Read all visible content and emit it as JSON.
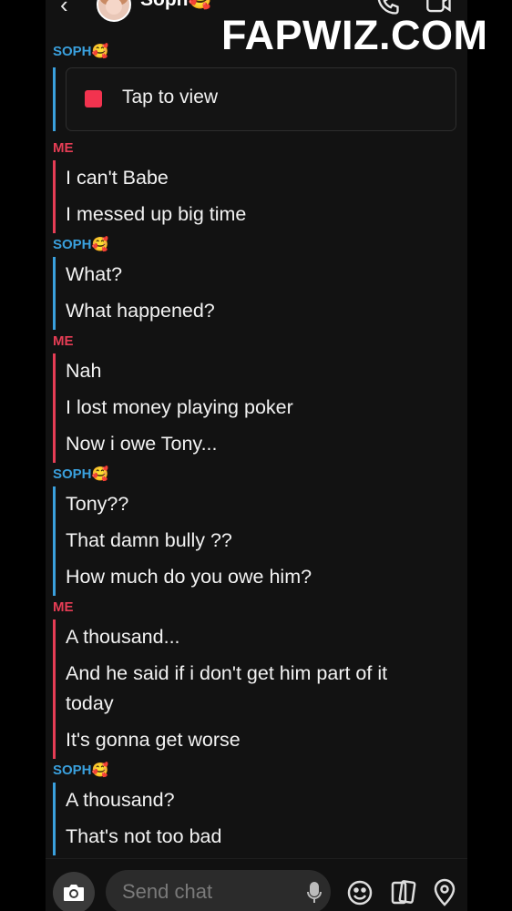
{
  "header": {
    "back_glyph": "‹",
    "contact_name": "Soph🥰",
    "avatar_icon": "avatar",
    "call_icon": "phone-icon",
    "video_icon": "video-icon"
  },
  "watermark": "FAPWIZ.COM",
  "chat": {
    "blocks": [
      {
        "sender": "SOPH🥰",
        "who": "soph",
        "snap": "Tap to view",
        "messages": []
      },
      {
        "sender": "ME",
        "who": "me",
        "messages": [
          "I can't Babe",
          "I messed up big time"
        ]
      },
      {
        "sender": "SOPH🥰",
        "who": "soph",
        "messages": [
          "What?",
          "What happened?"
        ]
      },
      {
        "sender": "ME",
        "who": "me",
        "messages": [
          "Nah",
          "I lost money playing poker",
          "Now i owe Tony..."
        ]
      },
      {
        "sender": "SOPH🥰",
        "who": "soph",
        "messages": [
          "Tony??",
          "That damn bully ??",
          "How much do you owe him?"
        ]
      },
      {
        "sender": "ME",
        "who": "me",
        "messages": [
          "A thousand...",
          "And he said if i don't get him part of it today",
          "It's gonna get worse"
        ]
      },
      {
        "sender": "SOPH🥰",
        "who": "soph",
        "messages": [
          "A thousand?",
          "That's not too bad"
        ]
      }
    ]
  },
  "composer": {
    "placeholder": "Send chat",
    "camera_icon": "camera-icon",
    "mic_icon": "microphone-icon",
    "emoji_icon": "emoji-icon",
    "cards_icon": "cards-icon",
    "location_icon": "location-pin-icon"
  },
  "colors": {
    "soph": "#3aa0dd",
    "me": "#e63d55",
    "snap_square": "#f2334f",
    "background": "#121212"
  }
}
